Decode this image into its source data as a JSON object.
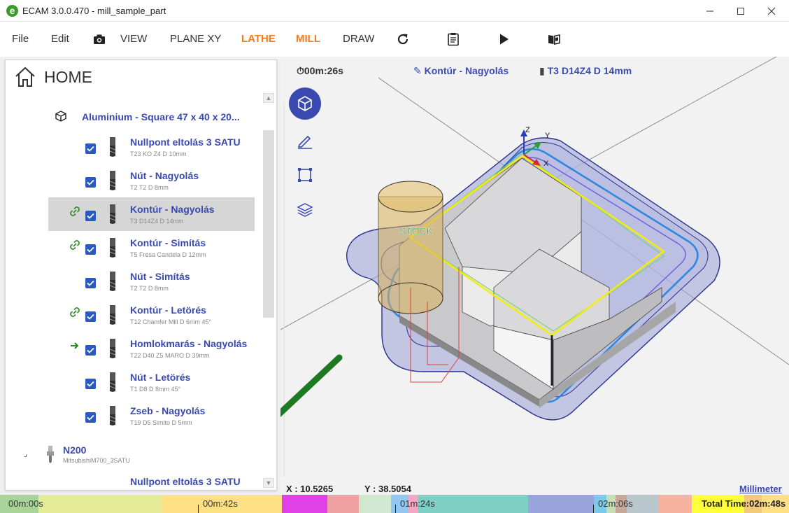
{
  "window": {
    "title": "ECAM 3.0.0.470 - mill_sample_part",
    "logo_letter": "e"
  },
  "menu": {
    "file": "File",
    "edit": "Edit",
    "view": "VIEW",
    "plane": "PLANE XY",
    "lathe": "LATHE",
    "mill": "MILL",
    "draw": "DRAW",
    "accent_orange": "#f07d1f"
  },
  "panel": {
    "home_title": "HOME",
    "stock": "Aluminium - Square 47 x 40 x 20...",
    "operations": [
      {
        "name": "Nullpont eltolás 3 SATU",
        "tool": "T23 KO Z4 D 10mm",
        "checked": true,
        "mark": "none",
        "selected": false
      },
      {
        "name": "Nút - Nagyolás",
        "tool": "T2 T2 D 8mm",
        "checked": true,
        "mark": "none",
        "selected": false
      },
      {
        "name": "Kontúr - Nagyolás",
        "tool": "T3 D14Z4 D 14mm",
        "checked": true,
        "mark": "link",
        "selected": true
      },
      {
        "name": "Kontúr - Simítás",
        "tool": "T5 Fresa Candela D 12mm",
        "checked": true,
        "mark": "link",
        "selected": false
      },
      {
        "name": "Nút - Simítás",
        "tool": "T2 T2 D 8mm",
        "checked": true,
        "mark": "none",
        "selected": false
      },
      {
        "name": "Kontúr - Letörés",
        "tool": "T12 Chamfer Mill D 6mm 45°",
        "checked": true,
        "mark": "link",
        "selected": false
      },
      {
        "name": "Homlokmarás - Nagyolás",
        "tool": "T22 D40 Z5 MARO D 39mm",
        "checked": true,
        "mark": "arrow",
        "selected": false
      },
      {
        "name": "Nút - Letörés",
        "tool": "T1 D8 D 8mm 45°",
        "checked": true,
        "mark": "none",
        "selected": false
      },
      {
        "name": "Zseb - Nagyolás",
        "tool": "T19 D5 Simito D 5mm",
        "checked": true,
        "mark": "none",
        "selected": false
      }
    ],
    "machine": {
      "expand": "⌟",
      "name": "N200",
      "controller": "MitsubishiM700_3SATU"
    },
    "cut_row": "Nullpont eltolás 3 SATU"
  },
  "viewport": {
    "time": "00m:26s",
    "operation": "Kontúr - Nagyolás",
    "tool": "T3 D14Z4 D 14mm",
    "stock_label": "STOCK",
    "axis_z": "Z",
    "axis_y": "Y",
    "axis_x": "X",
    "coord_x": "X : 10.5265",
    "coord_y": "Y : 38.5054",
    "units": "Millimeter",
    "accent_blue": "#3a4ab0"
  },
  "timeline": {
    "start": "00m:00s",
    "mark1": "00m:42s",
    "mark2": "01m:24s",
    "mark3": "02m:06s",
    "total": "Total Time:02m:48s",
    "segments": [
      {
        "color": "#a8d49a"
      },
      {
        "color": "#e5ec97"
      },
      {
        "color": "#ffe085"
      },
      {
        "color": "#e040e8"
      },
      {
        "color": "#f0a0a0"
      },
      {
        "color": "#cfe8cf"
      },
      {
        "color": "#92c8ef"
      },
      {
        "color": "#f3a7c0"
      },
      {
        "color": "#7ecfc4"
      },
      {
        "color": "#9aa4dc"
      },
      {
        "color": "#7cc9ea"
      },
      {
        "color": "#c5e0b4"
      },
      {
        "color": "#c9a89c"
      },
      {
        "color": "#b9c6cc"
      },
      {
        "color": "#f7b3a0"
      },
      {
        "color": "#ffff3a"
      },
      {
        "color": "#f3c97a"
      },
      {
        "color": "#ffe085"
      }
    ]
  }
}
